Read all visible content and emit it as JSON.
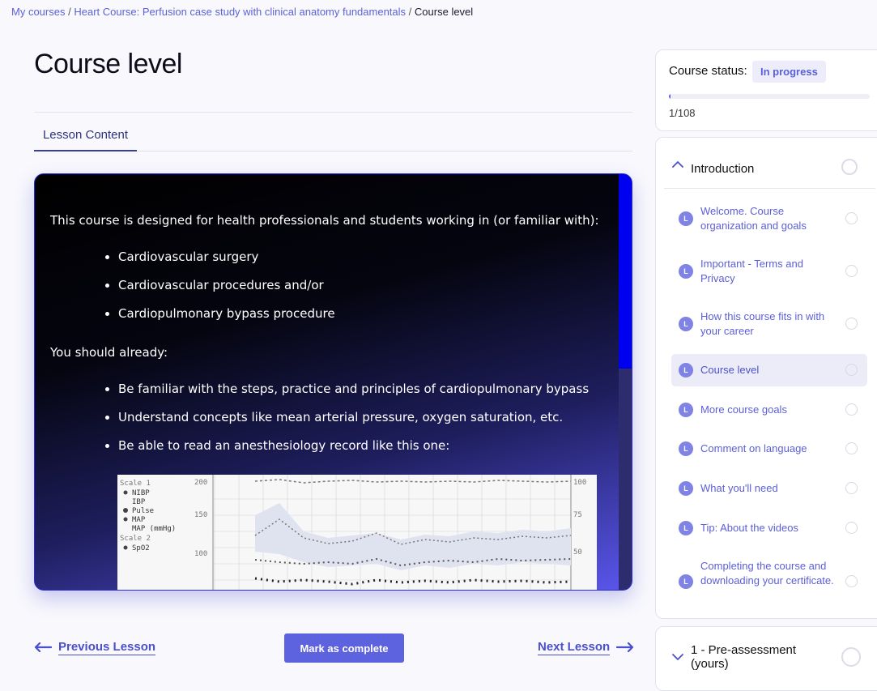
{
  "breadcrumb": {
    "items": [
      {
        "label": "My courses"
      },
      {
        "label": "Heart Course: Perfusion case study with clinical anatomy fundamentals"
      }
    ],
    "separator": "/",
    "current": "Course level"
  },
  "page_title": "Course level",
  "tabs": [
    {
      "label": "Lesson Content"
    }
  ],
  "content": {
    "intro": "This course is designed for health professionals and students working in (or familiar with):",
    "audience": [
      "Cardiovascular surgery",
      "Cardiovascular procedures and/or",
      "Cardiopulmonary bypass procedure"
    ],
    "prereq_intro": "You should already:",
    "prerequisites": [
      "Be familiar with the steps, practice and principles of cardiopulmonary bypass",
      "Understand concepts like mean arterial pressure, oxygen saturation, etc.",
      "Be able to read an anesthesiology record like this one:"
    ],
    "record_image": {
      "legend": [
        "Scale 1",
        "NIBP",
        "IBP",
        "Pulse",
        "MAP",
        "MAP (mmHg)",
        "Scale 2",
        "SpO2"
      ],
      "left_ticks": [
        "200",
        "150",
        "100"
      ],
      "right_ticks": [
        "100",
        "75",
        "50"
      ]
    }
  },
  "nav": {
    "previous": "Previous Lesson",
    "mark_complete": "Mark as complete",
    "next": "Next Lesson"
  },
  "status": {
    "label": "Course status:",
    "badge": "In progress",
    "progress_text": "1/108",
    "progress_fraction": 0.009
  },
  "sections": [
    {
      "title": "Introduction",
      "expanded": true,
      "lessons": [
        {
          "badge": "L",
          "label": "Welcome. Course organization and goals"
        },
        {
          "badge": "L",
          "label": "Important - Terms and Privacy"
        },
        {
          "badge": "L",
          "label": "How this course fits in with your career"
        },
        {
          "badge": "L",
          "label": "Course level",
          "active": true
        },
        {
          "badge": "L",
          "label": "More course goals"
        },
        {
          "badge": "L",
          "label": "Comment on language"
        },
        {
          "badge": "L",
          "label": "What you'll need"
        },
        {
          "badge": "L",
          "label": "Tip: About the videos"
        },
        {
          "badge": "L",
          "label": "Completing the course and downloading your certificate."
        }
      ]
    },
    {
      "title": "1 - Pre-assessment (yours)",
      "expanded": false
    }
  ],
  "colors": {
    "accent": "#5b5fd8",
    "button": "#5d62df",
    "scroll_thumb": "#0000f0"
  },
  "icons": {
    "previous": "arrow-left-icon",
    "next": "arrow-right-icon",
    "expanded": "chevron-up-icon",
    "collapsed": "chevron-down-icon",
    "lesson": "lesson-badge-icon",
    "status": "circle-status-icon"
  }
}
